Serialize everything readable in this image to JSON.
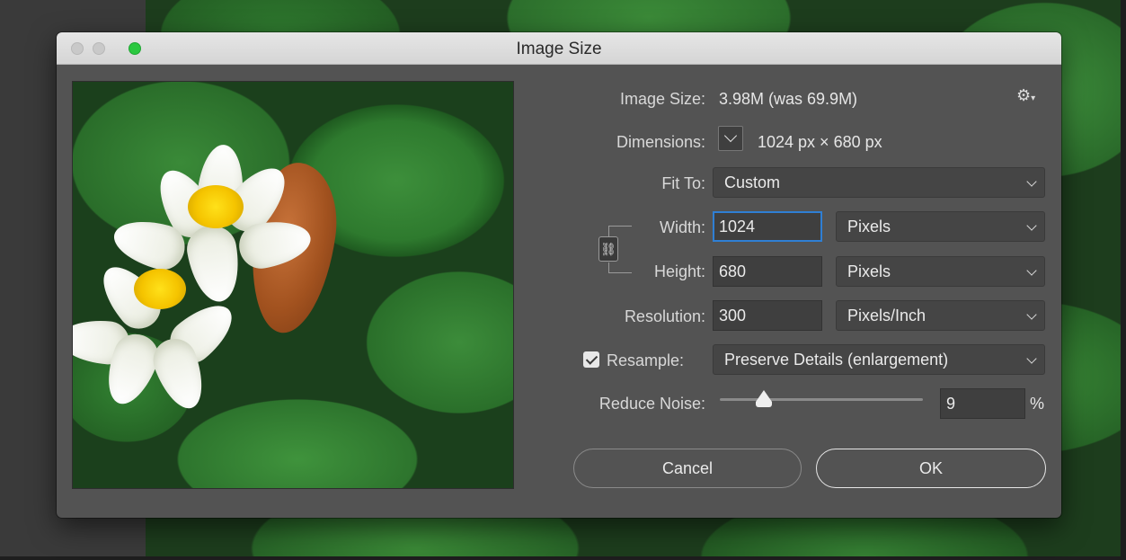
{
  "window": {
    "title": "Image Size"
  },
  "info": {
    "image_size_label": "Image Size:",
    "image_size_value": "3.98M (was 69.9M)",
    "dimensions_label": "Dimensions:",
    "dimensions_value": "1024 px  ×  680 px"
  },
  "fit_to": {
    "label": "Fit To:",
    "value": "Custom"
  },
  "width": {
    "label": "Width:",
    "value": "1024",
    "unit": "Pixels"
  },
  "height": {
    "label": "Height:",
    "value": "680",
    "unit": "Pixels"
  },
  "resolution": {
    "label": "Resolution:",
    "value": "300",
    "unit": "Pixels/Inch"
  },
  "resample": {
    "label": "Resample:",
    "checked": true,
    "method": "Preserve Details (enlargement)"
  },
  "reduce_noise": {
    "label": "Reduce Noise:",
    "value": "9",
    "unit": "%",
    "level_fraction": 0.09
  },
  "buttons": {
    "cancel": "Cancel",
    "ok": "OK"
  },
  "icons": {
    "settings": "gear-icon",
    "constrain": "link-icon",
    "dimensions_menu": "chevron-down-icon"
  },
  "colors": {
    "focus": "#2f7fd4",
    "dialog_bg": "#535353",
    "maximize": "#2bc840"
  }
}
